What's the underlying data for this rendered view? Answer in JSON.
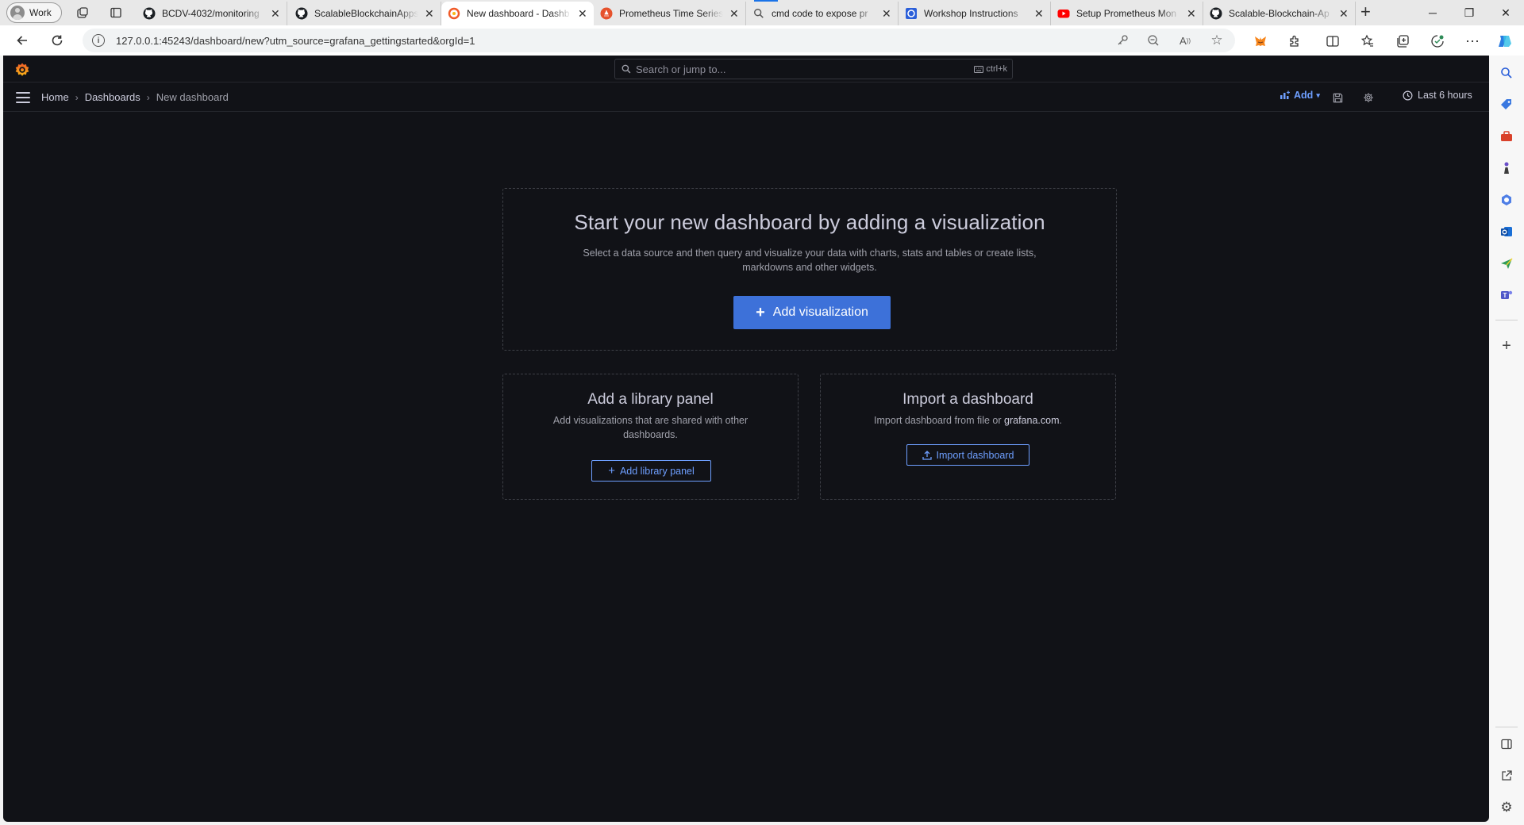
{
  "browser": {
    "profile_label": "Work",
    "tabs": [
      {
        "title": "BCDV-4032/monitoring",
        "icon": "github-icon",
        "active": false
      },
      {
        "title": "ScalableBlockchainApps",
        "icon": "github-icon",
        "active": false
      },
      {
        "title": "New dashboard - Dashb",
        "icon": "grafana-icon",
        "active": true
      },
      {
        "title": "Prometheus Time Series",
        "icon": "prometheus-icon",
        "active": false
      },
      {
        "title": "cmd code to expose pr",
        "icon": "search-icon",
        "active": false
      },
      {
        "title": "Workshop Instructions",
        "icon": "workshop-icon",
        "active": false
      },
      {
        "title": "Setup Prometheus Mon",
        "icon": "youtube-icon",
        "active": false
      },
      {
        "title": "Scalable-Blockchain-Ap",
        "icon": "github-icon",
        "active": false
      }
    ],
    "url": "127.0.0.1:45243/dashboard/new?utm_source=grafana_gettingstarted&orgId=1"
  },
  "grafana": {
    "search": {
      "placeholder": "Search or jump to...",
      "shortcut": "ctrl+k"
    },
    "breadcrumbs": [
      "Home",
      "Dashboards",
      "New dashboard"
    ],
    "add_label": "Add",
    "time_range": "Last 6 hours",
    "hero": {
      "title": "Start your new dashboard by adding a visualization",
      "description": "Select a data source and then query and visualize your data with charts, stats and tables or create lists, markdowns and other widgets.",
      "button": "Add visualization"
    },
    "library_panel": {
      "title": "Add a library panel",
      "description": "Add visualizations that are shared with other dashboards.",
      "button": "Add library panel"
    },
    "import": {
      "title": "Import a dashboard",
      "description_prefix": "Import dashboard from file or ",
      "description_link": "grafana.com",
      "description_suffix": ".",
      "button": "Import dashboard"
    }
  },
  "colors": {
    "grafana_bg": "#111217",
    "primary_button": "#3d71d9",
    "link_blue": "#6e9fff",
    "text_primary": "#ccccdc",
    "text_secondary": "#9fa0aa"
  }
}
